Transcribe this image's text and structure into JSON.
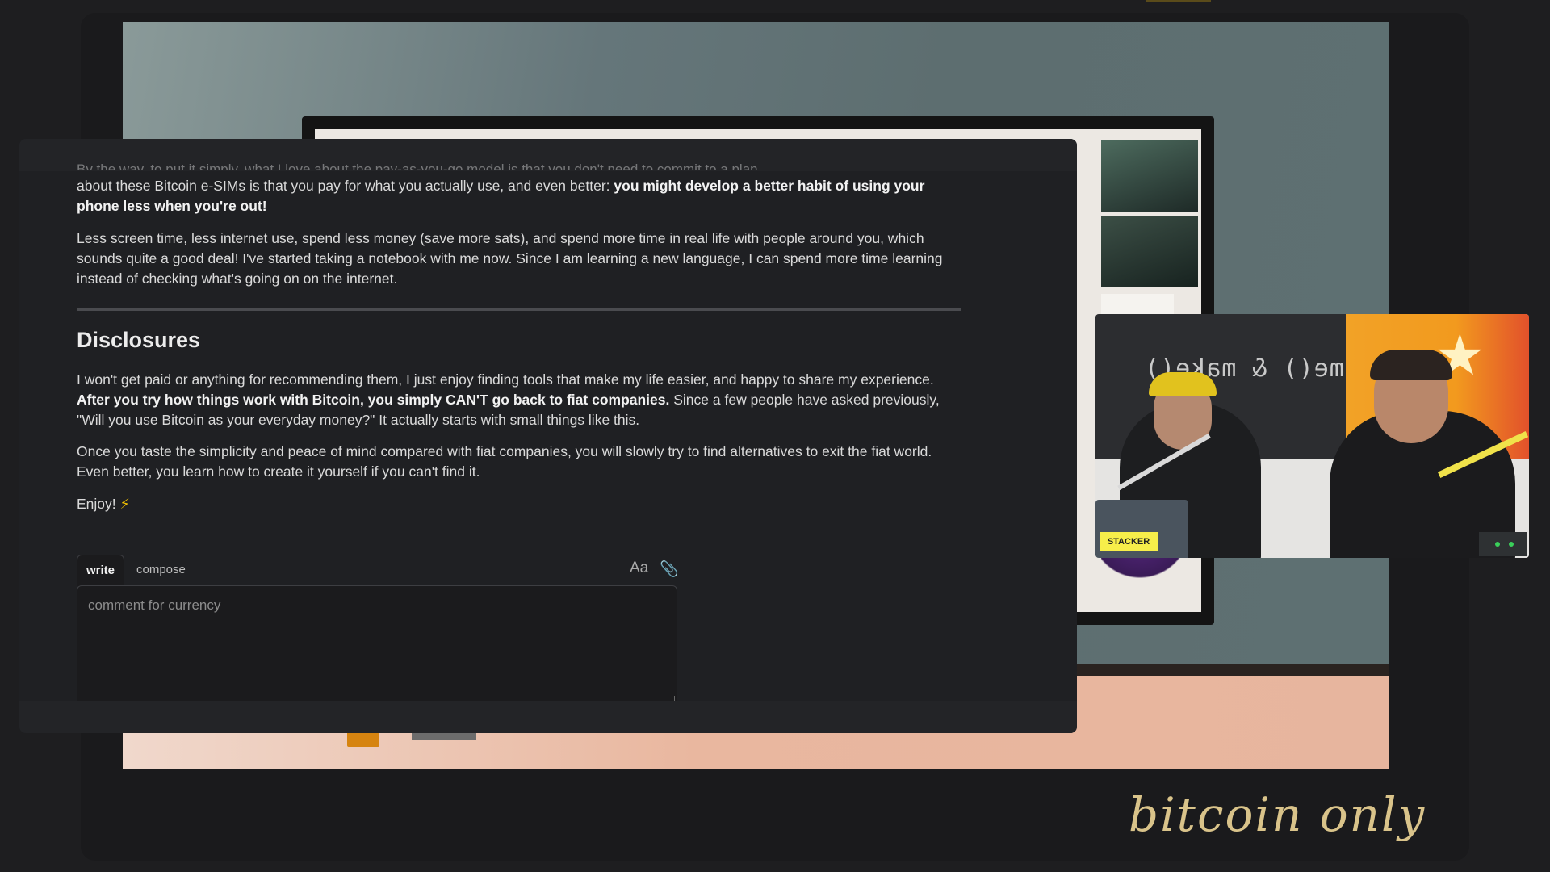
{
  "article": {
    "cut_line": "By the way, to put it simply, what I love about the pay-as-you-go model is that you don't need to commit to a plan.",
    "p1_text": "about these Bitcoin e-SIMs is that you pay for what you actually use, and even better: ",
    "p1_bold": "you might develop a better habit of using your phone less when you're out!",
    "p2": "Less screen time, less internet use, spend less money (save more sats), and spend more time in real life with people around you, which sounds quite a good deal! I've started taking a notebook with me now. Since I am learning a new language, I can spend more time learning instead of checking what's going on on the internet.",
    "heading": "Disclosures",
    "p3_a": "I won't get paid or anything for recommending them, I just enjoy finding tools that make my life easier, and happy to share my experience. ",
    "p3_bold": "After you try how things work with Bitcoin, you simply CAN'T go back to fiat companies.",
    "p3_b": " Since a few people have asked previously, \"Will you use Bitcoin as your everyday money?\" It actually starts with small things like this.",
    "p4": "Once you taste the simplicity and peace of mind compared with fiat companies, you will slowly try to find alternatives to exit the fiat world. Even better, you learn how to create it yourself if you can't find it.",
    "p5": "Enjoy!",
    "p5_emoji": "⚡"
  },
  "composer": {
    "tab_write": "write",
    "tab_compose": "compose",
    "font_tool": "Aa",
    "attach_tool": "📎",
    "placeholder": "comment for currency"
  },
  "webcam": {
    "banner_text": "come() & make()",
    "sticker_text": "STACKER"
  },
  "brand": {
    "text": "bitcoin only"
  }
}
